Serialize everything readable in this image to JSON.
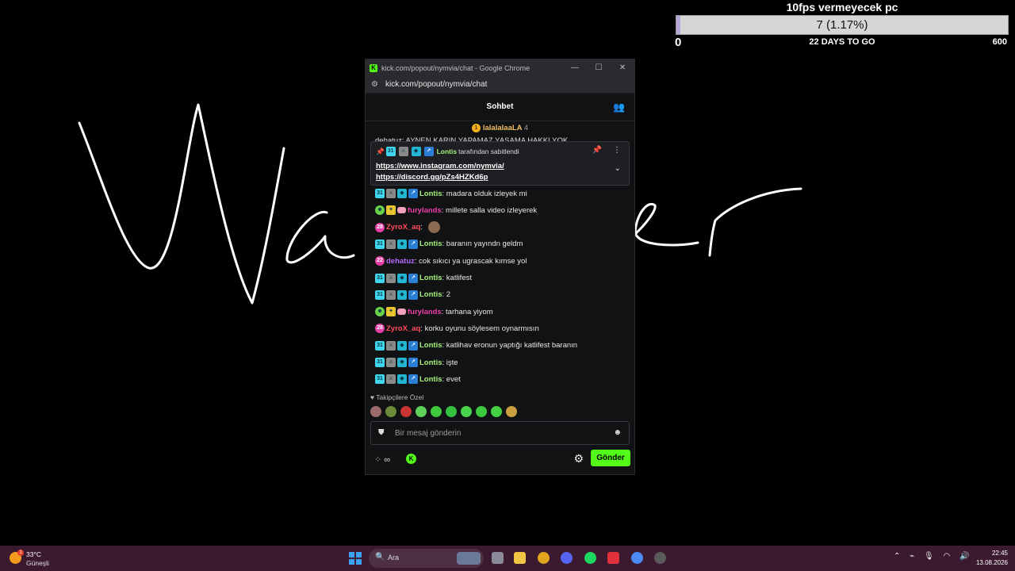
{
  "goal": {
    "title": "10fps vermeyecek pc",
    "progress_text": "7 (1.17%)",
    "progress_fraction": 0.0117,
    "min": "0",
    "days_left": "22 DAYS TO GO",
    "max": "600"
  },
  "window": {
    "title": "kick.com/popout/nymvia/chat - Google Chrome",
    "url": "kick.com/popout/nymvia/chat",
    "minimize_icon": "minimize-icon",
    "maximize_icon": "maximize-icon",
    "close_icon": "close-icon"
  },
  "chat": {
    "header": "Sohbet",
    "top_user": "lalalalaaLA",
    "top_count": "4",
    "cutoff_line": "dehatuz: AYNEN KARIN YAPAMAZ YAŞAMA HAKKI YOK",
    "pinned": {
      "user": "Lontis",
      "suffix": "tarafından sabitlendi",
      "link1": "https://www.instagram.com/nymvia/",
      "link2": "https://discord.gg/pZs4HZKd6p"
    },
    "messages": [
      {
        "user": "Lontis",
        "text": "madara olduk izleyek mi",
        "style": "lontis"
      },
      {
        "user": "furylands",
        "text": "millete salla video izleyerek",
        "style": "fury"
      },
      {
        "user": "ZyroX_aq",
        "text": "",
        "style": "zyro"
      },
      {
        "user": "Lontis",
        "text": "baranın yayındn geldm",
        "style": "lontis"
      },
      {
        "user": "dehatuz",
        "text": "cok sıkıcı ya ugrascak kımse yol",
        "style": "deha"
      },
      {
        "user": "Lontis",
        "text": "katlifest",
        "style": "lontis"
      },
      {
        "user": "Lontis",
        "text": "2",
        "style": "lontis"
      },
      {
        "user": "furylands",
        "text": "tarhana yiyom",
        "style": "fury"
      },
      {
        "user": "ZyroX_aq",
        "text": "korku oyunu söylesem oynarmısın",
        "style": "zyro"
      },
      {
        "user": "Lontis",
        "text": "katlihav eronun yaptığı katlifest baranın",
        "style": "lontis"
      },
      {
        "user": "Lontis",
        "text": "işte",
        "style": "lontis"
      },
      {
        "user": "Lontis",
        "text": "evet",
        "style": "lontis"
      }
    ],
    "emote_label": "Takipçilere Özel",
    "input_placeholder": "Bir mesaj gönderin",
    "send_label": "Gönder"
  },
  "taskbar": {
    "temperature": "33°C",
    "condition": "Güneşli",
    "weather_badge": "1",
    "search_placeholder": "Ara",
    "time": "22:45",
    "date": "13.08.2026"
  },
  "colors": {
    "kick_green": "#53fc18",
    "lontis": "#a6f27a",
    "furylands": "#ee3fa8",
    "zyrox": "#ff4d5a",
    "dehatuz": "#b86bff",
    "taskbar": "#3b1a2f"
  }
}
